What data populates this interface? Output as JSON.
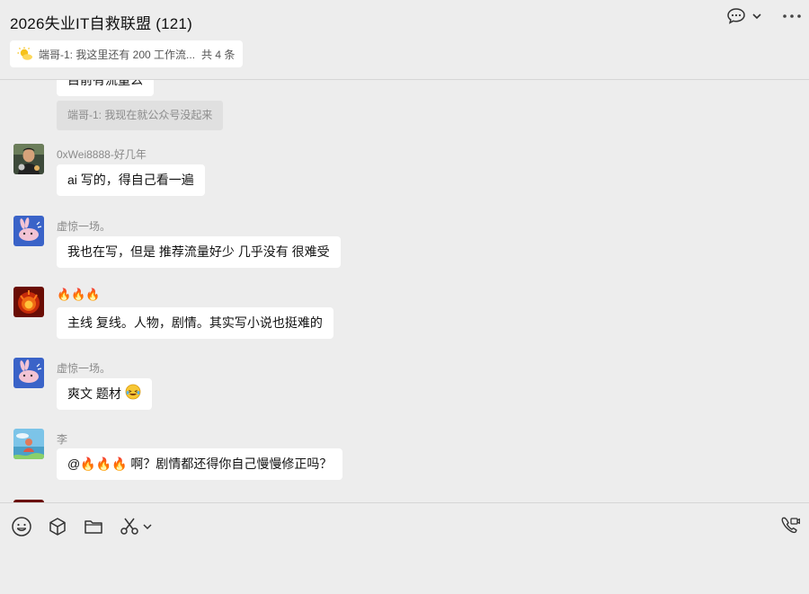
{
  "window": {
    "title": "2026失业IT自救联盟 (121)"
  },
  "header": {
    "icons": [
      "chat-history-icon",
      "chevron-down-icon",
      "more-icon"
    ]
  },
  "pinned": {
    "icon": "sun-cloud-icon",
    "text": "端哥-1: 我这里还有 200 工作流...",
    "count": "共 4 条"
  },
  "messages": [
    {
      "type": "partial",
      "text": "目前有流量么"
    },
    {
      "type": "quote",
      "text": "端哥-1: 我现在就公众号没起来"
    },
    {
      "type": "message",
      "sender": "0xWei8888-好几年",
      "avatar": "avatar-photo-person",
      "text": "ai 写的，得自己看一遍"
    },
    {
      "type": "message",
      "sender": "虚惊一场。",
      "avatar": "avatar-pink-rabbit",
      "text": "我也在写，但是 推荐流量好少 几乎没有 很难受"
    },
    {
      "type": "message",
      "sender": "🔥🔥🔥",
      "avatar": "avatar-fire",
      "text": "主线 复线。人物，剧情。其实写小说也挺难的"
    },
    {
      "type": "message",
      "sender": "虚惊一场。",
      "avatar": "avatar-pink-rabbit",
      "text": "爽文 题材",
      "emoji": "laughing-tears-emoji"
    },
    {
      "type": "message",
      "sender": "李",
      "avatar": "avatar-sky-landscape",
      "text": "@🔥🔥🔥 啊？剧情都还得你自己慢慢修正吗？"
    }
  ],
  "toolbar": {
    "icons": [
      "emoji-icon",
      "cube-icon",
      "folder-icon",
      "scissors-icon",
      "chevron-down-icon"
    ],
    "right_icon": "video-call-icon"
  },
  "colors": {
    "background": "#ededed",
    "bubble": "#ffffff",
    "quote": "#e0e0e0",
    "sender": "#8a8a8a"
  }
}
